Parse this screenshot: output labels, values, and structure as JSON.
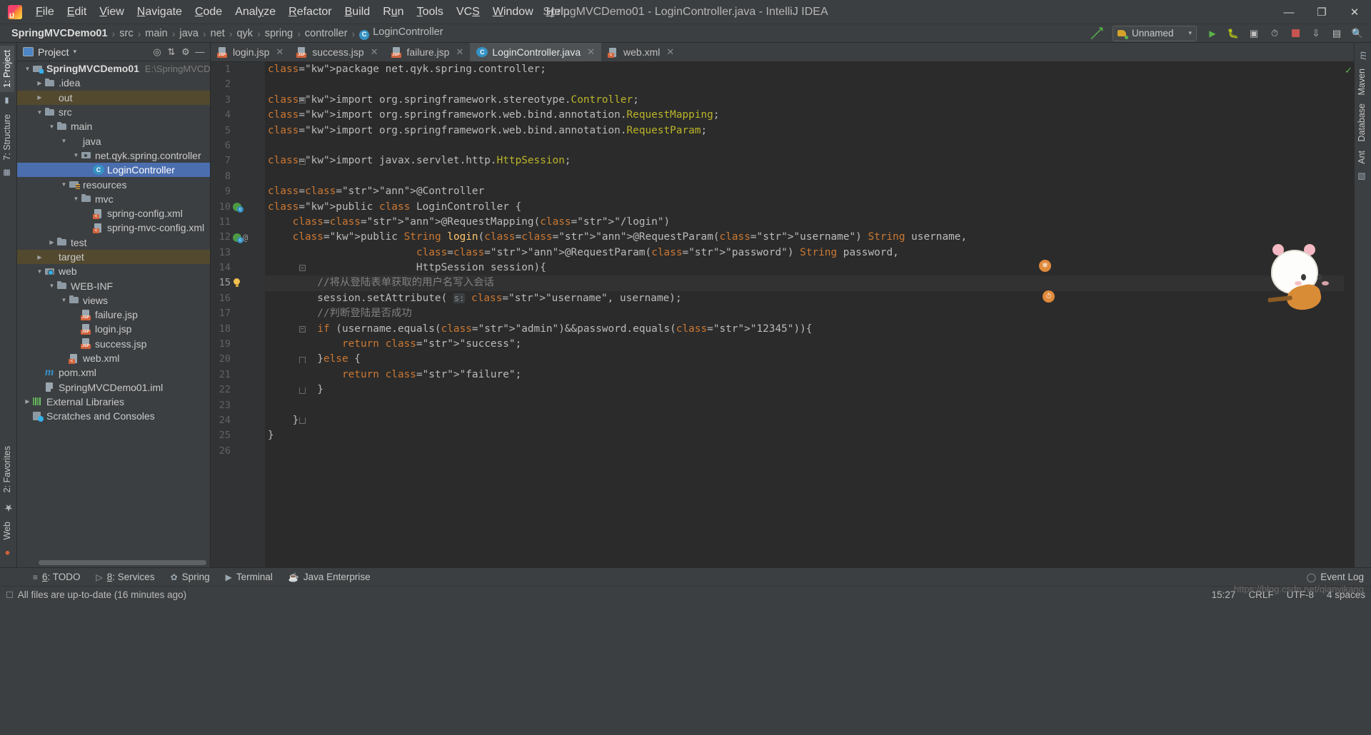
{
  "window": {
    "title": "SpringMVCDemo01 - LoginController.java - IntelliJ IDEA",
    "minimize": "—",
    "maximize": "❐",
    "close": "✕"
  },
  "menu": {
    "items": [
      "File",
      "Edit",
      "View",
      "Navigate",
      "Code",
      "Analyze",
      "Refactor",
      "Build",
      "Run",
      "Tools",
      "VCS",
      "Window",
      "Help"
    ]
  },
  "breadcrumb": {
    "items": [
      "SpringMVCDemo01",
      "src",
      "main",
      "java",
      "net",
      "qyk",
      "spring",
      "controller",
      "LoginController"
    ],
    "class_icon_letter": "C",
    "separator": "›"
  },
  "toolbar": {
    "run_config": "Unnamed",
    "run_config_icon": "tomcat-icon",
    "back_icon": "back-arrow-icon",
    "buttons": [
      "run-button",
      "debug-button",
      "coverage-button",
      "profiler-button",
      "stop-button",
      "update-button",
      "layout-button",
      "search-button"
    ]
  },
  "left_strip": {
    "top": [
      {
        "label": "1: Project",
        "icon": "project-icon",
        "active": true
      },
      {
        "label": "",
        "icon": "folder-icon",
        "active": false
      },
      {
        "label": "7: Structure",
        "icon": "structure-icon",
        "active": false
      }
    ],
    "bottom": [
      {
        "label": "2: Favorites",
        "icon": "star-icon"
      },
      {
        "label": "Web",
        "icon": "web-icon"
      }
    ]
  },
  "right_strip": {
    "items": [
      "m",
      "Maven",
      "Database",
      "Ant"
    ]
  },
  "project_panel": {
    "title": "Project",
    "caret": "▾",
    "icons": [
      "locate-icon",
      "collapse-all-icon",
      "gear-icon",
      "hide-icon"
    ],
    "tree": [
      {
        "depth": 0,
        "twist": "▼",
        "icon": "module",
        "label": "SpringMVCDemo01",
        "bold": true,
        "path": "E:\\SpringMVCDem",
        "state": "normal"
      },
      {
        "depth": 1,
        "twist": "▶",
        "icon": "folder",
        "label": ".idea",
        "state": "normal"
      },
      {
        "depth": 1,
        "twist": "▶",
        "icon": "folder-orange",
        "label": "out",
        "state": "dim"
      },
      {
        "depth": 1,
        "twist": "▼",
        "icon": "folder",
        "label": "src",
        "state": "normal"
      },
      {
        "depth": 2,
        "twist": "▼",
        "icon": "folder",
        "label": "main",
        "state": "normal"
      },
      {
        "depth": 3,
        "twist": "▼",
        "icon": "folder-blue",
        "label": "java",
        "state": "normal"
      },
      {
        "depth": 4,
        "twist": "▼",
        "icon": "pkg",
        "label": "net.qyk.spring.controller",
        "state": "normal"
      },
      {
        "depth": 5,
        "twist": "",
        "icon": "cls",
        "label": "LoginController",
        "state": "selected"
      },
      {
        "depth": 3,
        "twist": "▼",
        "icon": "res",
        "label": "resources",
        "state": "normal"
      },
      {
        "depth": 4,
        "twist": "▼",
        "icon": "folder",
        "label": "mvc",
        "state": "normal"
      },
      {
        "depth": 5,
        "twist": "",
        "icon": "file-xml",
        "label": "spring-config.xml",
        "state": "normal"
      },
      {
        "depth": 5,
        "twist": "",
        "icon": "file-xml",
        "label": "spring-mvc-config.xml",
        "state": "normal"
      },
      {
        "depth": 2,
        "twist": "▶",
        "icon": "folder",
        "label": "test",
        "state": "normal"
      },
      {
        "depth": 1,
        "twist": "▶",
        "icon": "folder-orange",
        "label": "target",
        "state": "dim"
      },
      {
        "depth": 1,
        "twist": "▼",
        "icon": "webdir",
        "label": "web",
        "state": "normal"
      },
      {
        "depth": 2,
        "twist": "▼",
        "icon": "folder",
        "label": "WEB-INF",
        "state": "normal"
      },
      {
        "depth": 3,
        "twist": "▼",
        "icon": "folder",
        "label": "views",
        "state": "normal"
      },
      {
        "depth": 4,
        "twist": "",
        "icon": "file-jsp",
        "label": "failure.jsp",
        "state": "normal"
      },
      {
        "depth": 4,
        "twist": "",
        "icon": "file-jsp",
        "label": "login.jsp",
        "state": "normal"
      },
      {
        "depth": 4,
        "twist": "",
        "icon": "file-jsp",
        "label": "success.jsp",
        "state": "normal"
      },
      {
        "depth": 3,
        "twist": "",
        "icon": "file-xml",
        "label": "web.xml",
        "state": "normal"
      },
      {
        "depth": 1,
        "twist": "",
        "icon": "maven",
        "label": "pom.xml",
        "state": "normal"
      },
      {
        "depth": 1,
        "twist": "",
        "icon": "iml",
        "label": "SpringMVCDemo01.iml",
        "state": "normal"
      },
      {
        "depth": 0,
        "twist": "▶",
        "icon": "libs",
        "label": "External Libraries",
        "state": "normal"
      },
      {
        "depth": 0,
        "twist": "",
        "icon": "scratch",
        "label": "Scratches and Consoles",
        "state": "normal"
      }
    ]
  },
  "editor_tabs": [
    {
      "label": "login.jsp",
      "icon": "file-jsp",
      "active": false,
      "close": "✕"
    },
    {
      "label": "success.jsp",
      "icon": "file-jsp",
      "active": false,
      "close": "✕"
    },
    {
      "label": "failure.jsp",
      "icon": "file-jsp",
      "active": false,
      "close": "✕"
    },
    {
      "label": "LoginController.java",
      "icon": "cls",
      "active": true,
      "close": "✕"
    },
    {
      "label": "web.xml",
      "icon": "file-xml",
      "active": false,
      "close": "✕"
    }
  ],
  "editor": {
    "current_line": 15,
    "inspection_status": "ok",
    "lines": [
      {
        "n": 1,
        "fold": "",
        "marker": "",
        "indent": 0
      },
      {
        "n": 2,
        "fold": "",
        "marker": "",
        "indent": 0
      },
      {
        "n": 3,
        "fold": "collapse-top",
        "marker": "",
        "indent": 0
      },
      {
        "n": 4,
        "fold": "",
        "marker": "",
        "indent": 0
      },
      {
        "n": 5,
        "fold": "",
        "marker": "",
        "indent": 0
      },
      {
        "n": 6,
        "fold": "",
        "marker": "",
        "indent": 0
      },
      {
        "n": 7,
        "fold": "collapse-bottom",
        "marker": "",
        "indent": 0
      },
      {
        "n": 8,
        "fold": "",
        "marker": "",
        "indent": 0
      },
      {
        "n": 9,
        "fold": "",
        "marker": "",
        "indent": 0
      },
      {
        "n": 10,
        "fold": "",
        "marker": "bean",
        "indent": 0
      },
      {
        "n": 11,
        "fold": "",
        "marker": "",
        "indent": 0
      },
      {
        "n": 12,
        "fold": "",
        "marker": "bean-at",
        "indent": 0
      },
      {
        "n": 13,
        "fold": "",
        "marker": "",
        "indent": 0
      },
      {
        "n": 14,
        "fold": "collapse-top",
        "marker": "",
        "indent": 0
      },
      {
        "n": 15,
        "fold": "",
        "marker": "bulb",
        "indent": 0
      },
      {
        "n": 16,
        "fold": "",
        "marker": "",
        "indent": 0
      },
      {
        "n": 17,
        "fold": "",
        "marker": "",
        "indent": 0
      },
      {
        "n": 18,
        "fold": "collapse-top",
        "marker": "",
        "indent": 0
      },
      {
        "n": 19,
        "fold": "",
        "marker": "",
        "indent": 0
      },
      {
        "n": 20,
        "fold": "collapse-mid",
        "marker": "",
        "indent": 0
      },
      {
        "n": 21,
        "fold": "",
        "marker": "",
        "indent": 0
      },
      {
        "n": 22,
        "fold": "collapse-bottom",
        "marker": "",
        "indent": 0
      },
      {
        "n": 23,
        "fold": "",
        "marker": "",
        "indent": 0
      },
      {
        "n": 24,
        "fold": "collapse-bottom",
        "marker": "",
        "indent": 0
      },
      {
        "n": 25,
        "fold": "",
        "marker": "",
        "indent": 0
      },
      {
        "n": 26,
        "fold": "",
        "marker": "",
        "indent": 0
      }
    ],
    "code_text": [
      "package net.qyk.spring.controller;",
      "",
      "import org.springframework.stereotype.Controller;",
      "import org.springframework.web.bind.annotation.RequestMapping;",
      "import org.springframework.web.bind.annotation.RequestParam;",
      "",
      "import javax.servlet.http.HttpSession;",
      "",
      "@Controller",
      "public class LoginController {",
      "    @RequestMapping(\"/login\")",
      "    public String login(@RequestParam(\"username\") String username,",
      "                        @RequestParam(\"password\") String password,",
      "                        HttpSession session){",
      "        //将从登陆表单获取的用户名写入会话",
      "        session.setAttribute( s: \"username\", username);",
      "        //判断登陆是否成功",
      "        if (username.equals(\"admin\")&&password.equals(\"12345\")){",
      "            return \"success\";",
      "        }else {",
      "            return \"failure\";",
      "        }",
      "",
      "    }",
      "}",
      ""
    ]
  },
  "bottom_bar": {
    "items": [
      {
        "label": "6: TODO",
        "icon": "todo-icon",
        "mnemonic": "6"
      },
      {
        "label": "8: Services",
        "icon": "services-icon",
        "mnemonic": "8"
      },
      {
        "label": "Spring",
        "icon": "spring-icon",
        "mnemonic": ""
      },
      {
        "label": "Terminal",
        "icon": "terminal-icon",
        "mnemonic": ""
      },
      {
        "label": "Java Enterprise",
        "icon": "java-enterprise-icon",
        "mnemonic": ""
      }
    ],
    "event_log": "Event Log",
    "event_log_icon": "event-log-icon"
  },
  "status_bar": {
    "message": "All files are up-to-date (16 minutes ago)",
    "message_icon": "sync-icon",
    "time": "15:27",
    "line_sep": "CRLF",
    "encoding": "UTF-8",
    "indent": "4 spaces",
    "watermark": "https://blog.csdn.net/qianyikang"
  }
}
